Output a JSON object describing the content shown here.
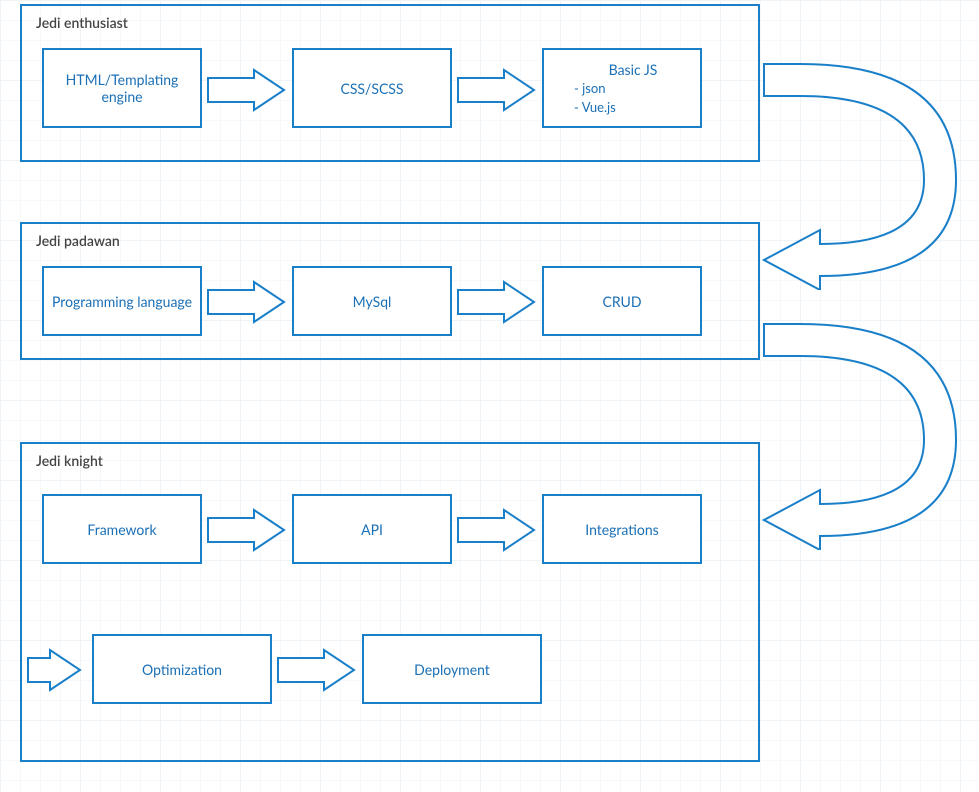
{
  "colors": {
    "stroke": "#1a7fc9",
    "text": "#1a6fb5",
    "title": "#444"
  },
  "stages": [
    {
      "id": "enthusiast",
      "title": "Jedi enthusiast",
      "nodes": [
        {
          "id": "html-templating",
          "label": "HTML/Templating engine"
        },
        {
          "id": "css-scss",
          "label": "CSS/SCSS"
        },
        {
          "id": "basic-js",
          "label": "Basic JS",
          "sub": [
            "- json",
            "- Vue.js"
          ]
        }
      ]
    },
    {
      "id": "padawan",
      "title": "Jedi padawan",
      "nodes": [
        {
          "id": "programming-language",
          "label": "Programming language"
        },
        {
          "id": "mysql",
          "label": "MySql"
        },
        {
          "id": "crud",
          "label": "CRUD"
        }
      ]
    },
    {
      "id": "knight",
      "title": "Jedi knight",
      "nodes": [
        {
          "id": "framework",
          "label": "Framework"
        },
        {
          "id": "api",
          "label": "API"
        },
        {
          "id": "integrations",
          "label": "Integrations"
        },
        {
          "id": "optimization",
          "label": "Optimization"
        },
        {
          "id": "deployment",
          "label": "Deployment"
        }
      ]
    }
  ],
  "flow_description": "Within each stage nodes connect left-to-right with block arrows; large curved arrows on the right connect stage 1 → stage 2 and stage 2 → stage 3; a small arrow feeds into Optimization from the left edge of the knight stage."
}
